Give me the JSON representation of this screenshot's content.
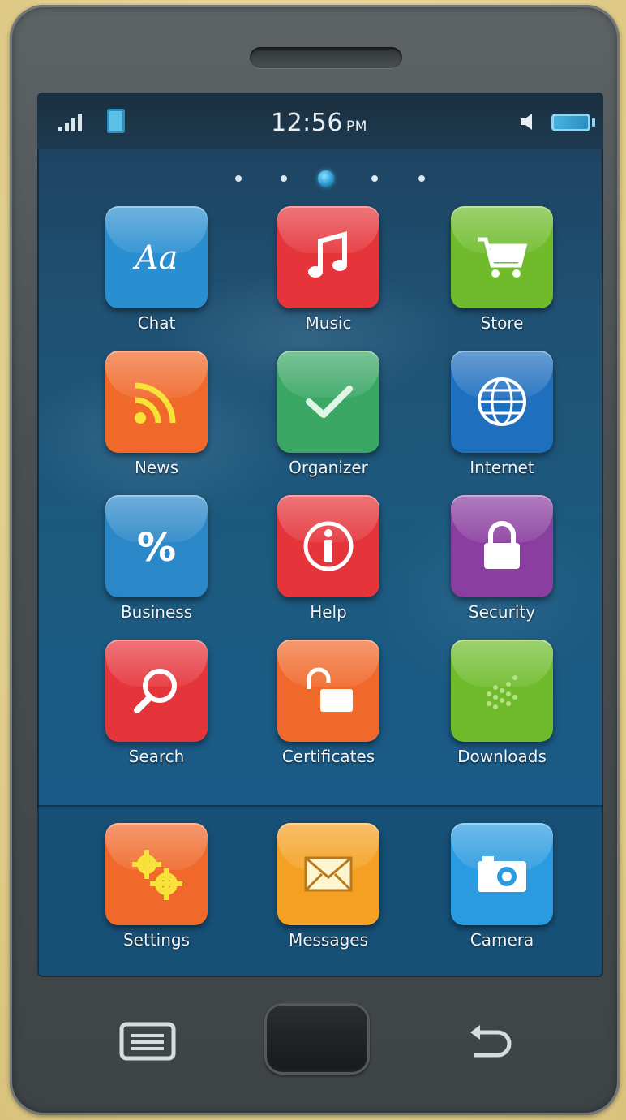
{
  "status_bar": {
    "time": "12:56",
    "ampm": "PM",
    "signal_icon": "signal-bars-icon",
    "sim_icon": "sim-card-icon",
    "volume_icon": "volume-icon",
    "battery_icon": "battery-icon"
  },
  "pager": {
    "page_count": 5,
    "active_page": 3
  },
  "apps": [
    {
      "label": "Chat",
      "icon": "chat-aa-icon",
      "color": "#2a8fd0"
    },
    {
      "label": "Music",
      "icon": "music-note-icon",
      "color": "#e5343a"
    },
    {
      "label": "Store",
      "icon": "shopping-cart-icon",
      "color": "#6fbb2c"
    },
    {
      "label": "News",
      "icon": "rss-icon",
      "color": "#f0682a"
    },
    {
      "label": "Organizer",
      "icon": "checkmark-icon",
      "color": "#3aa765"
    },
    {
      "label": "Internet",
      "icon": "globe-icon",
      "color": "#1f6fbf"
    },
    {
      "label": "Business",
      "icon": "percent-icon",
      "color": "#2a87c8"
    },
    {
      "label": "Help",
      "icon": "info-icon",
      "color": "#e5343a"
    },
    {
      "label": "Security",
      "icon": "padlock-icon",
      "color": "#8a3fa0"
    },
    {
      "label": "Search",
      "icon": "search-icon",
      "color": "#e5343a"
    },
    {
      "label": "Certificates",
      "icon": "unlocked-padlock-icon",
      "color": "#f0682a"
    },
    {
      "label": "Downloads",
      "icon": "download-arrow-icon",
      "color": "#6fbb2c"
    }
  ],
  "dock": [
    {
      "label": "Settings",
      "icon": "gears-icon",
      "color": "#f0682a"
    },
    {
      "label": "Messages",
      "icon": "envelope-icon",
      "color": "#f5a023"
    },
    {
      "label": "Camera",
      "icon": "camera-icon",
      "color": "#2a9be0"
    }
  ],
  "navigation": {
    "menu_icon": "menu-icon",
    "home_icon": "home-button-icon",
    "back_icon": "back-arrow-icon"
  }
}
